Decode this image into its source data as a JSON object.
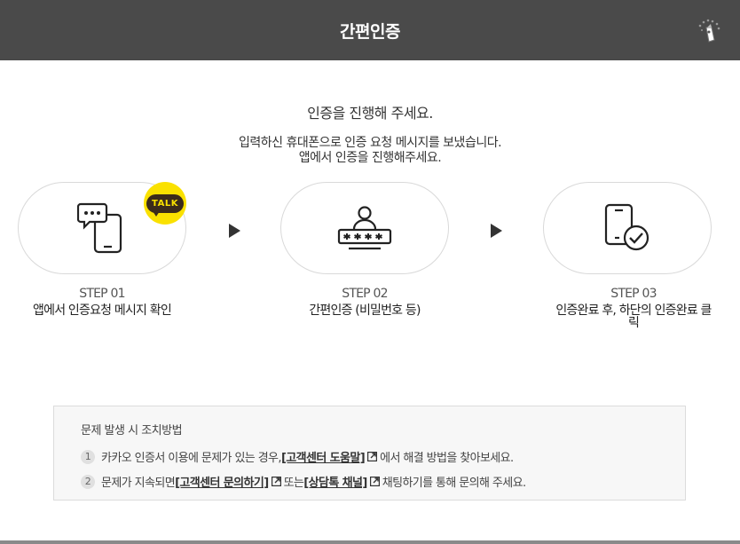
{
  "header": {
    "title": "간편인증",
    "logo_icon": "wand-stars-icon"
  },
  "intro": {
    "title": "인증을 진행해 주세요.",
    "line1": "입력하신 휴대폰으로 인증 요청 메시지를 보냈습니다.",
    "line2": "앱에서 인증을 진행해주세요."
  },
  "steps": [
    {
      "label": "STEP 01",
      "desc": "앱에서 인증요청 메시지 확인",
      "icon": "phone-chat-icon",
      "badge": "TALK"
    },
    {
      "label": "STEP 02",
      "desc": "간편인증 (비밀번호 등)",
      "icon": "user-password-icon"
    },
    {
      "label": "STEP 03",
      "desc_line1": "인증완료 후, 하단의 인증완료 클",
      "desc_line2": "릭",
      "icon": "phone-check-icon"
    }
  ],
  "help": {
    "title": "문제 발생 시 조치방법",
    "items": [
      {
        "num": "1",
        "prefix": "카카오 인증서 이용에 문제가 있는 경우, ",
        "link": "[고객센터 도움말]",
        "suffix": "에서 해결 방법을 찾아보세요."
      },
      {
        "num": "2",
        "prefix": "문제가 지속되면 ",
        "link1": "[고객센터 문의하기]",
        "middle": "또는 ",
        "link2": "[상담톡 채널]",
        "suffix": "채팅하기를 통해 문의해 주세요."
      }
    ]
  },
  "colors": {
    "header_bg": "#4a4a4a",
    "kakao_yellow": "#fae100",
    "kakao_brown": "#3b2b1b"
  }
}
